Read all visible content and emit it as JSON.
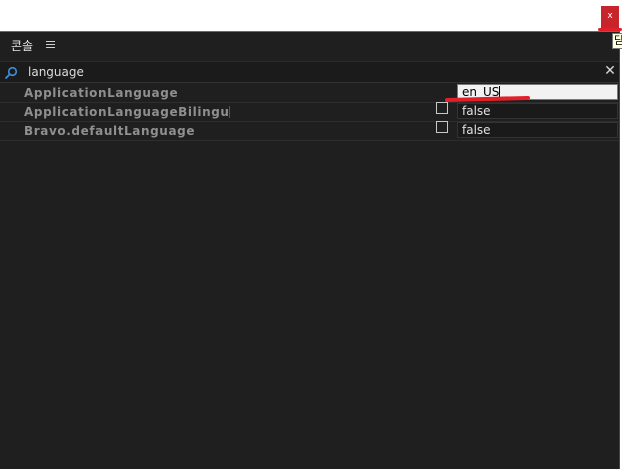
{
  "window": {
    "close_label": "x",
    "close_color": "#c8242b",
    "tooltip_text": "닫"
  },
  "panel": {
    "title": "콘솔",
    "menu_icon": "hamburger-menu-icon"
  },
  "search": {
    "value": "language",
    "icon": "search-icon",
    "clear_label": "✕"
  },
  "properties": [
    {
      "name": "ApplicationLanguage",
      "value": "en_US",
      "has_checkbox": false,
      "checked": false,
      "editing": true
    },
    {
      "name": "ApplicationLanguageBilingual",
      "value": "false",
      "has_checkbox": true,
      "checked": false,
      "editing": false
    },
    {
      "name": "Bravo.defaultLanguage",
      "value": "false",
      "has_checkbox": true,
      "checked": false,
      "editing": false
    }
  ],
  "colors": {
    "panel_bg": "#1f1f1f",
    "annotation_red": "#e2202a"
  }
}
